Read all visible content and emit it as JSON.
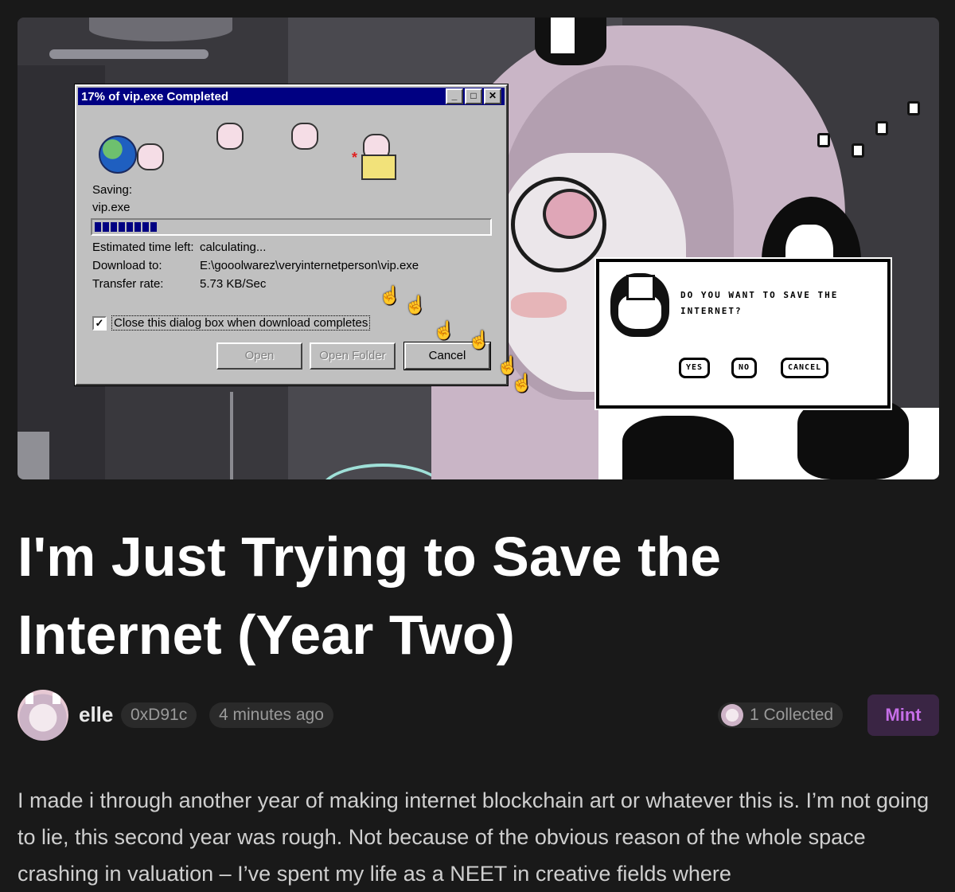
{
  "hero": {
    "dialog": {
      "title": "17% of vip.exe Completed",
      "minimize": "_",
      "maximize": "□",
      "close": "✕",
      "saving_label": "Saving:",
      "filename": "vip.exe",
      "progress": 0.17,
      "eta_label": "Estimated time left:",
      "eta_value": "calculating...",
      "download_label": "Download to:",
      "download_value": "E:\\gooolwarez\\veryinternetperson\\vip.exe",
      "rate_label": "Transfer rate:",
      "rate_value": "5.73 KB/Sec",
      "checkbox_checked": true,
      "checkbox_mark": "✓",
      "checkbox_label": "Close this dialog box when download completes",
      "open_button": "Open",
      "open_folder_button": "Open Folder",
      "cancel_button": "Cancel"
    },
    "pixel_dialog": {
      "message": "DO YOU WANT TO SAVE THE INTERNET?",
      "yes": "YES",
      "no": "NO",
      "cancel": "CANCEL"
    }
  },
  "article": {
    "title": "I'm Just Trying to Save the Internet (Year Two)",
    "author": "elle",
    "address": "0xD91c",
    "time": "4 minutes ago",
    "collected": "1 Collected",
    "mint_label": "Mint",
    "body": "I made i through another year of making internet blockchain art or whatever this is. I’m not going to lie, this second year was rough. Not because of the obvious reason of the whole space crashing in valuation – I’ve spent my life as a NEET in creative fields where"
  },
  "colors": {
    "background": "#191919",
    "mint_text": "#c56ee8",
    "mint_bg": "#3a2544",
    "win_title": "#000082"
  }
}
